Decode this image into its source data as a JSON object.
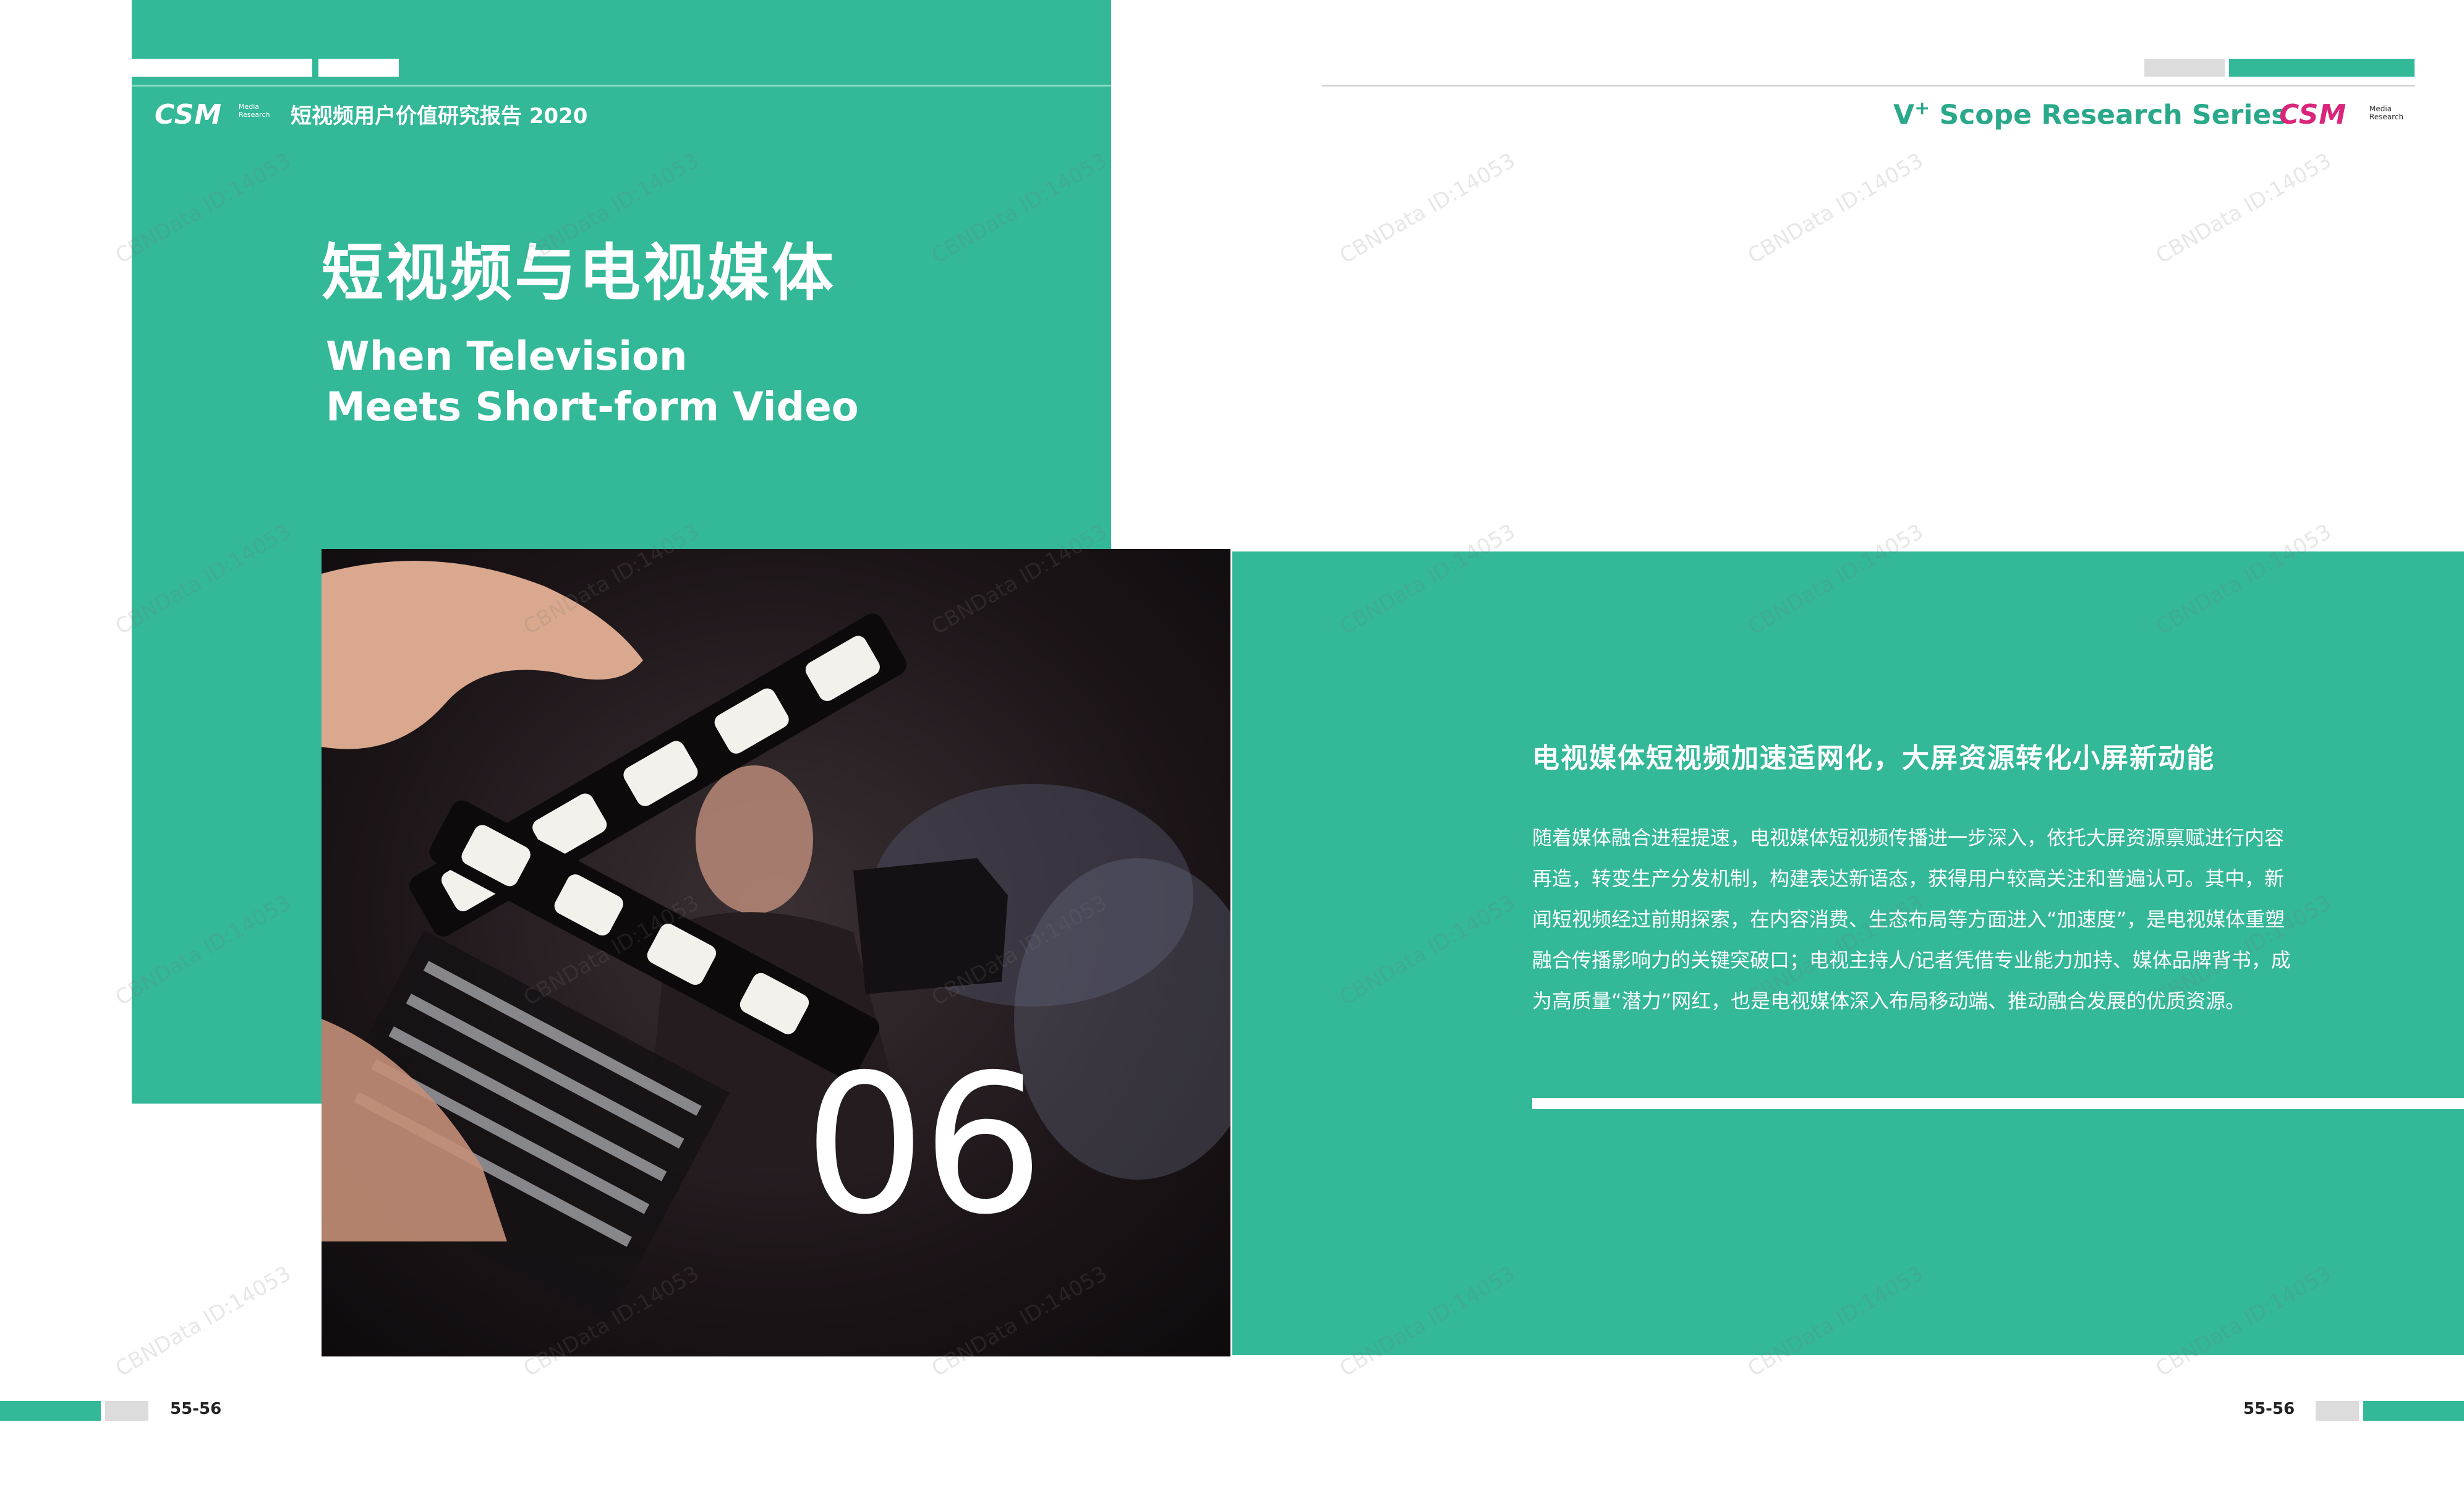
{
  "header_left": {
    "logo_text": "CSM",
    "logo_subtext": "Media Research",
    "report_title": "短视频用户价值研究报告 2020"
  },
  "header_right": {
    "series_prefix": "V",
    "series_sup": "+",
    "series_title": "Scope Research Series",
    "logo_text": "CSM",
    "logo_subtext": "Media Research"
  },
  "chapter": {
    "title_cn": "短视频与电视媒体",
    "title_en_line1": "When Television",
    "title_en_line2": "Meets Short-form Video",
    "number": "06"
  },
  "section": {
    "heading": "电视媒体短视频加速适网化，大屏资源转化小屏新动能",
    "body": "随着媒体融合进程提速，电视媒体短视频传播进一步深入，依托大屏资源禀赋进行内容再造，转变生产分发机制，构建表达新语态，获得用户较高关注和普遍认可。其中，新闻短视频经过前期探索，在内容消费、生态布局等方面进入“加速度”，是电视媒体重塑融合传播影响力的关键突破口；电视主持人/记者凭借专业能力加持、媒体品牌背书，成为高质量“潜力”网红，也是电视媒体深入布局移动端、推动融合发展的优质资源。"
  },
  "footer": {
    "page_left": "55-56",
    "page_right": "55-56"
  },
  "watermark": "CBNData ID:14053",
  "colors": {
    "brand_green": "#33b898",
    "csm_pink": "#d9267a",
    "series_green": "#2aa88a"
  }
}
